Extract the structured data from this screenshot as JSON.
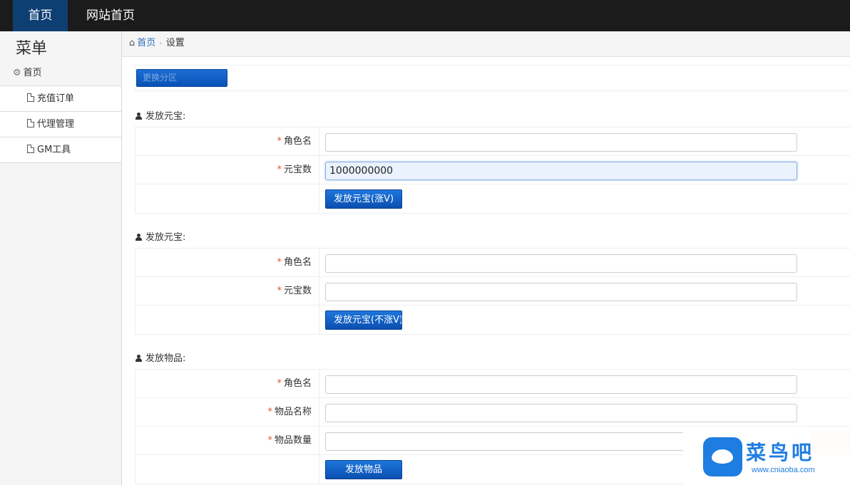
{
  "topnav": {
    "home_label": "首页",
    "site_label": "网站首页"
  },
  "sidebar": {
    "title": "菜单",
    "group_label": "首页",
    "items": [
      {
        "label": "充值订单"
      },
      {
        "label": "代理管理"
      },
      {
        "label": "GM工具"
      }
    ]
  },
  "breadcrumb": {
    "home": "首页",
    "current": "设置"
  },
  "switch_button_label": "更换分区",
  "sections": [
    {
      "title": "发放元宝:",
      "fields": [
        {
          "label": "角色名",
          "value": "",
          "placeholder": ""
        },
        {
          "label": "元宝数",
          "value": "1000000000",
          "placeholder": ""
        }
      ],
      "action": "发放元宝(涨V)"
    },
    {
      "title": "发放元宝:",
      "fields": [
        {
          "label": "角色名",
          "value": "",
          "placeholder": ""
        },
        {
          "label": "元宝数",
          "value": "",
          "placeholder": ""
        }
      ],
      "action": "发放元宝(不涨V)"
    },
    {
      "title": "发放物品:",
      "fields": [
        {
          "label": "角色名",
          "value": "",
          "placeholder": ""
        },
        {
          "label": "物品名称",
          "value": "",
          "placeholder": ""
        },
        {
          "label": "物品数量",
          "value": "",
          "placeholder": ""
        }
      ],
      "action": "发放物品"
    }
  ],
  "watermark": {
    "text": "菜鸟吧",
    "url": "www.cniaoba.com"
  },
  "colors": {
    "topbar": "#1b1b1b",
    "active_nav": "#0d3f73",
    "button_blue": "#0a52b5",
    "required_star": "#e8552a",
    "link": "#2a6fb8"
  }
}
